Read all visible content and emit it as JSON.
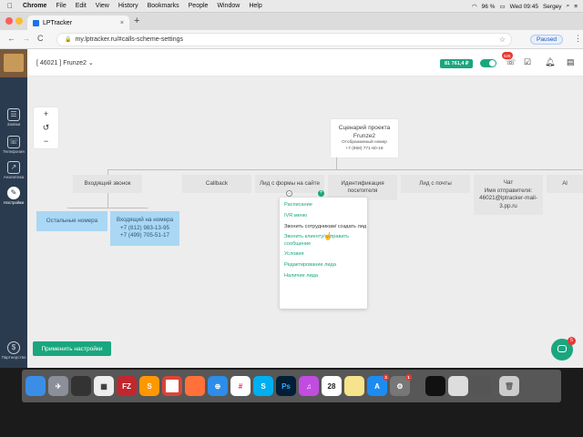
{
  "menubar": {
    "apple": "",
    "app": "Chrome",
    "items": [
      "File",
      "Edit",
      "View",
      "History",
      "Bookmarks",
      "People",
      "Window",
      "Help"
    ],
    "battery": "96 %",
    "clock": "Wed 09:45",
    "user": "Sergey"
  },
  "browser": {
    "tab_title": "LPTracker",
    "tab_close": "×",
    "new_tab": "+",
    "url": "my.lptracker.ru/#calls-scheme-settings",
    "paused_label": "Paused",
    "back": "←",
    "forward": "→",
    "reload": "C"
  },
  "sidebar": {
    "items": [
      {
        "label": "Заявки",
        "icon": "leads-icon"
      },
      {
        "label": "Телефония",
        "icon": "telephony-icon"
      },
      {
        "label": "Аналитика",
        "icon": "analytics-icon"
      },
      {
        "label": "Настройки",
        "icon": "settings-icon"
      }
    ],
    "partner_label": "Партнерство"
  },
  "header": {
    "project": "[ 46021 ] Frunze2",
    "balance": "81 761,4 ₽",
    "notifications_badge": "526"
  },
  "zoom": {
    "plus": "+",
    "reset": "↺",
    "minus": "−"
  },
  "scenario": {
    "title": "Сценарий проекта",
    "name": "Frunze2",
    "number_label": "Отображаемый номер",
    "number": "+7 (968) 771-60-18"
  },
  "branches": [
    {
      "label": "Входящий звонок"
    },
    {
      "label": "Callback"
    },
    {
      "label": "Лид с формы на сайте"
    },
    {
      "label": "Идентификация посетителя"
    },
    {
      "label": "Лид с почты"
    },
    {
      "label": "Чат",
      "extra": "Имя отправителя:",
      "extra2": "46021@lptracker-mail-3.pp.ru"
    },
    {
      "label": "Al"
    }
  ],
  "incoming_children": [
    {
      "label": "Остальные номера"
    },
    {
      "label": "Входящий на номера",
      "lines": [
        "+7 (812) 983-13-95",
        "+7 (499) 705-51-17"
      ]
    }
  ],
  "dropdown": {
    "options": [
      "Расписание",
      "IVR меню",
      "Звонить сотрудникам/ создать лид",
      "Звонить клиенту/отправить сообщение",
      "Условия",
      "Редактирование лида",
      "Наличие лида"
    ],
    "hover_index": 2
  },
  "actions": {
    "apply": "Применить настройки",
    "chat_badge": "5"
  },
  "dock": {
    "apps": [
      "Finder",
      "Launchpad",
      "Monitor",
      "Vectorworks",
      "FileZilla",
      "Sublime",
      "Chrome",
      "Firefox",
      "Safari",
      "Slack",
      "Skype",
      "Photoshop",
      "Audio",
      "Calendar",
      "Notes",
      "App Store",
      "Preferences",
      "Terminal",
      "Screen",
      "Window",
      "Trash"
    ],
    "calendar_day": "28",
    "badges": {
      "App Store": "3",
      "Preferences": "1"
    }
  },
  "colors": {
    "accent": "#1aa67e",
    "sidebar": "#2b3b4f",
    "node": "#e5e5e5",
    "blue_node": "#aad7f3",
    "badge": "#e53935"
  }
}
